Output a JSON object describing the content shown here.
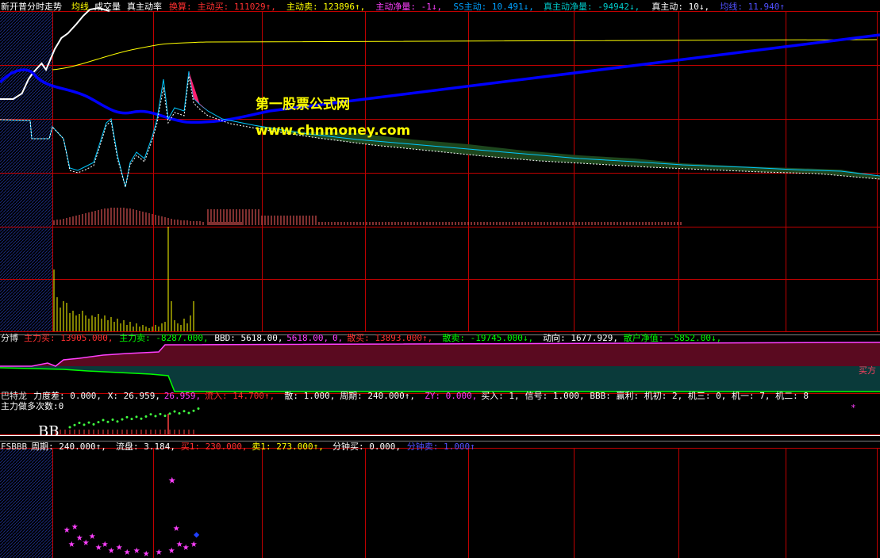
{
  "panel1": {
    "title": "新开普分时走势",
    "items": [
      {
        "text": "均线",
        "color": "#ffff00"
      },
      {
        "text": "成交量",
        "color": "#ffffff"
      },
      {
        "text": "真主动率",
        "color": "#ffffff"
      },
      {
        "text": "换算:",
        "color": "#ff3030"
      },
      {
        "text": "主动买: 111029↑,",
        "color": "#ff3030"
      },
      {
        "text": "主动卖: 123896↑,",
        "color": "#ffff00"
      },
      {
        "text": "主动净量: -1↓,",
        "color": "#ff40ff"
      },
      {
        "text": "SS主动: 10.491↓,",
        "color": "#00a0ff"
      },
      {
        "text": "真主动净量: -94942↓,",
        "color": "#00c8c8"
      },
      {
        "text": "真主动: 10↓,",
        "color": "#ffffff"
      },
      {
        "text": "均线: 11.940↑",
        "color": "#5050ff"
      }
    ]
  },
  "panel3": {
    "items": [
      {
        "text": "分博",
        "color": "#e0e0e0"
      },
      {
        "text": "主力买: 13905.000,",
        "color": "#ff3030"
      },
      {
        "text": "主力卖: -8287.000,",
        "color": "#00ff00"
      },
      {
        "text": "BBD: 5618.00,",
        "color": "#ffffff"
      },
      {
        "text": "5618.00,",
        "color": "#ff40ff"
      },
      {
        "text": "0,",
        "color": "#ff40ff"
      },
      {
        "text": "散买: 13893.000↑,",
        "color": "#ff3030"
      },
      {
        "text": "散卖: -19745.000↓,",
        "color": "#00ff00"
      },
      {
        "text": "动向: 1677.929,",
        "color": "#ffffff"
      },
      {
        "text": "散户净值: -5852.00↓,",
        "color": "#00ff00"
      }
    ],
    "right_label": "买方"
  },
  "panel4": {
    "items": [
      {
        "text": "巴特龙",
        "color": "#e0e0e0"
      },
      {
        "text": "力度差: 0.000,",
        "color": "#ffffff"
      },
      {
        "text": "X: 26.959,",
        "color": "#ffffff"
      },
      {
        "text": "26.959,",
        "color": "#ff40ff"
      },
      {
        "text": "流入: 14.700↑,",
        "color": "#ff3030"
      },
      {
        "text": "散: 1.000,",
        "color": "#ffffff"
      },
      {
        "text": "周期: 240.000↑,",
        "color": "#ffffff"
      },
      {
        "text": "ZY: 0.000,",
        "color": "#ff40ff"
      },
      {
        "text": "买入: 1,",
        "color": "#ffffff"
      },
      {
        "text": "信号: 1.000,",
        "color": "#ffffff"
      },
      {
        "text": "BBB: 赢利: 机初: 2, 机三: 0, 机一: 7, 机二: 8",
        "color": "#ffffff"
      }
    ],
    "line2": "主力做多次数:0",
    "bb_label": "BB"
  },
  "panel5": {
    "items": [
      {
        "text": "FSBBB",
        "color": "#e0e0e0"
      },
      {
        "text": "周期: 240.000↑,",
        "color": "#ffffff"
      },
      {
        "text": "流盘: 3.184,",
        "color": "#ffffff"
      },
      {
        "text": "买1: 230.000,",
        "color": "#ff3030"
      },
      {
        "text": "卖1: 273.000↑,",
        "color": "#ffff00"
      },
      {
        "text": "分钟买: 0.000,",
        "color": "#ffffff"
      },
      {
        "text": "分钟卖: 1.000↑",
        "color": "#5050ff"
      }
    ]
  },
  "watermark": {
    "line1": "第一股票公式网",
    "line2": "www.chnmoney.com"
  },
  "colors": {
    "grid": "#c00000",
    "price": "#ffffff",
    "avg": "#ffff00",
    "blue": "#0000ff",
    "wm": "#ffff00"
  },
  "chart_data": {
    "type": "line",
    "minutes": 240,
    "series": [
      {
        "name": "均线",
        "values": [
          0,
          0.1,
          0.22,
          0.35,
          0.5,
          0.62,
          0.73,
          0.82,
          0.88,
          0.93,
          0.97,
          1.0
        ]
      }
    ]
  }
}
